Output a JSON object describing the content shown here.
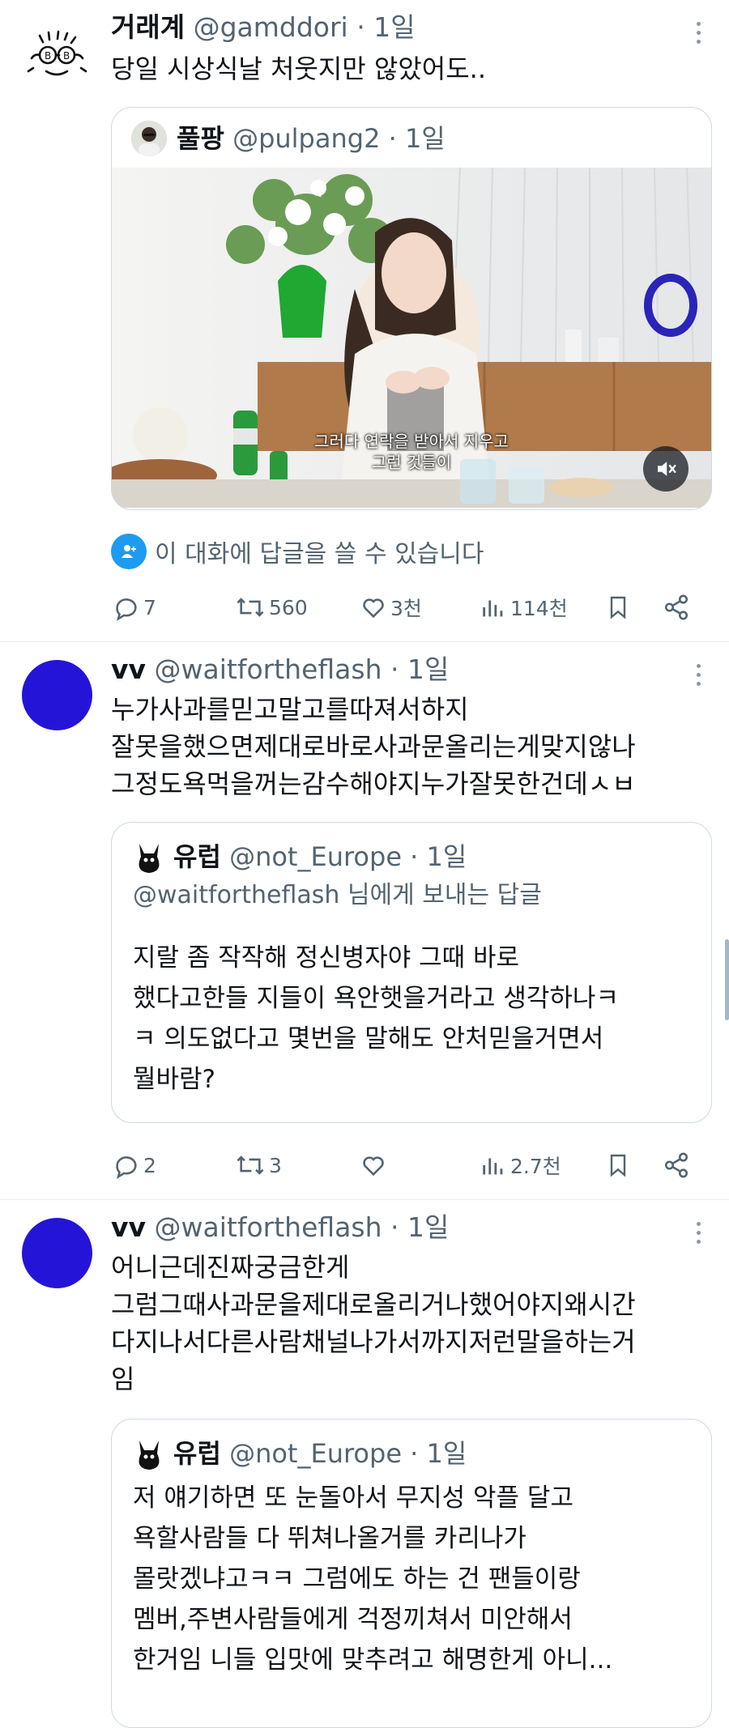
{
  "tweets": [
    {
      "name": "거래계",
      "handle": "@gamddori",
      "sep": "·",
      "time": "1일",
      "lines": [
        "당일 시상식날 처웃지만 않았어도.."
      ],
      "quote": {
        "name": "풀팡",
        "handle": "@pulpang2",
        "time": "1일",
        "video_caption_1": "그러다 연락을 받아서 지우고",
        "video_caption_2": "그런 것들이",
        "mute_icon": "mute-icon"
      },
      "reply_permission": "이 대화에 답글을 쓸 수 있습니다",
      "stats": {
        "replies": "7",
        "retweets": "560",
        "likes": "3천",
        "views": "114천"
      }
    },
    {
      "name": "vv",
      "handle": "@waitfortheflash",
      "sep": "·",
      "time": "1일",
      "lines": [
        "누가사과를믿고말고를따져서하지",
        "잘못을했으면제대로바로사과문올리는게맞지않나",
        "그정도욕먹을꺼는감수해야지누가잘못한건데ㅅㅂ"
      ],
      "quote": {
        "name": "유럽",
        "handle": "@not_Europe",
        "time": "1일",
        "reply_to": "@waitfortheflash 님에게 보내는 답글",
        "lines": [
          "지랄 좀 작작해 정신병자야 그때 바로",
          "했다고한들 지들이 욕안햇을거라고 생각하나ㅋ",
          "ㅋ 의도없다고 몇번을 말해도 안처믿을거면서",
          "뭘바람?"
        ]
      },
      "stats": {
        "replies": "2",
        "retweets": "3",
        "likes": "",
        "views": "2.7천"
      }
    },
    {
      "name": "vv",
      "handle": "@waitfortheflash",
      "sep": "·",
      "time": "1일",
      "lines": [
        "어니근데진짜궁금한게",
        "그럼그때사과문을제대로올리거나했어야지왜시간",
        "다지나서다른사람채널나가서까지저런말을하는거",
        "임"
      ],
      "quote": {
        "name": "유럽",
        "handle": "@not_Europe",
        "time": "1일",
        "lines": [
          "저 얘기하면 또 눈돌아서 무지성 악플 달고",
          "욕할사람들 다 뛰쳐나올거를 카리나가",
          "몰랏겠냐고ㅋㅋ 그럼에도 하는 건 팬들이랑",
          "멤버,주변사람들에게 걱정끼쳐서 미안해서",
          "한거임 니들 입맛에 맞추려고 해명한게 아니..."
        ]
      }
    }
  ],
  "colors": {
    "text": "#0f1419",
    "muted": "#536471",
    "accent": "#1d9bf0",
    "avatar_blue": "#2414d8",
    "border": "#cfd9de"
  }
}
